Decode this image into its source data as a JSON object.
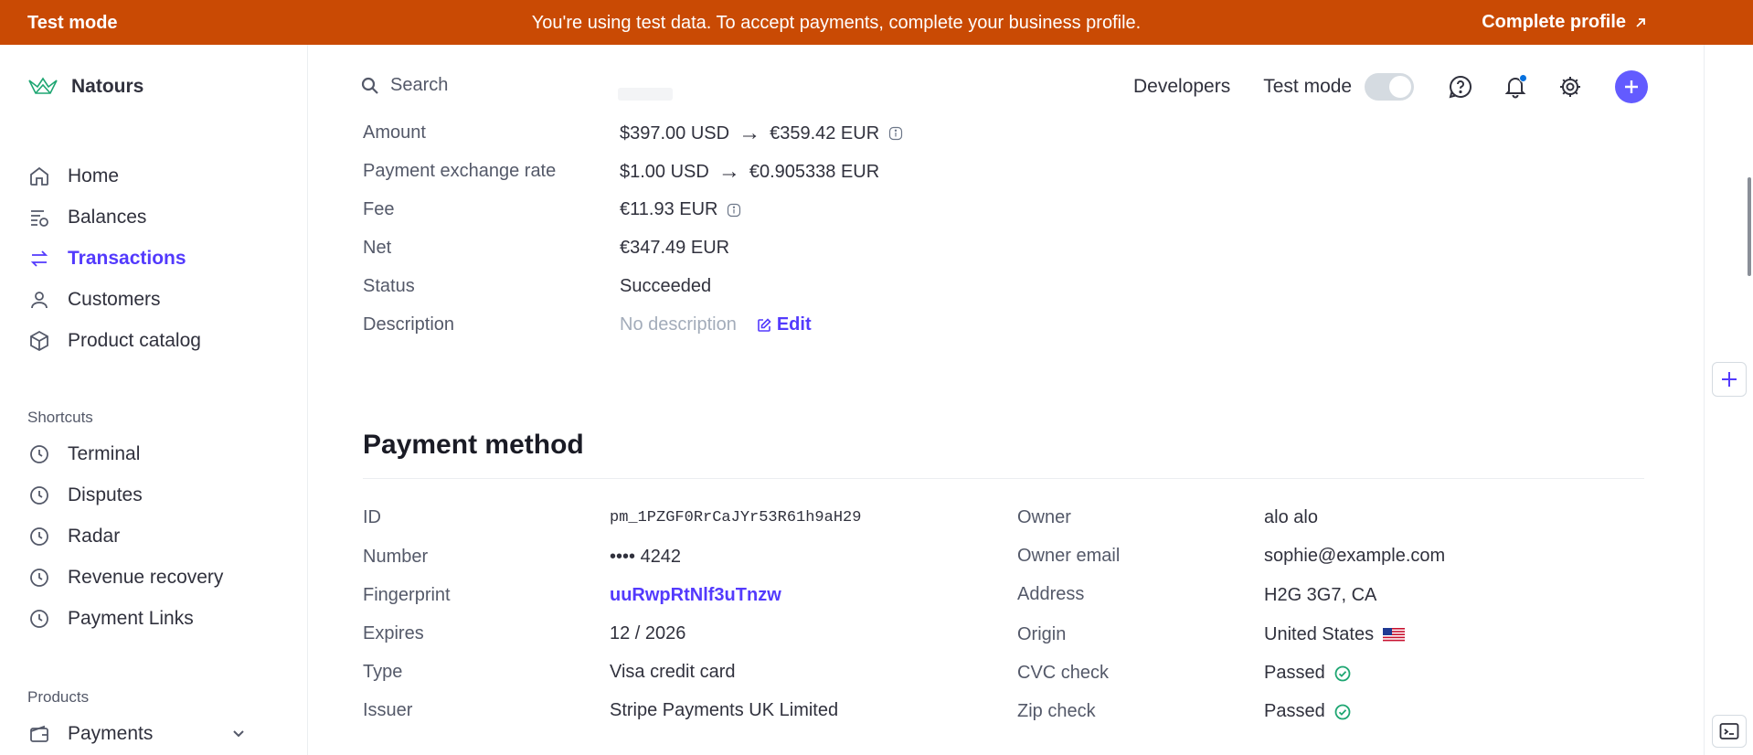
{
  "banner": {
    "mode_label": "Test mode",
    "message": "You're using test data. To accept payments, complete your business profile.",
    "cta": "Complete profile"
  },
  "brand": {
    "name": "Natours",
    "color": "#1ea672"
  },
  "nav": {
    "items": [
      {
        "label": "Home",
        "icon": "home-icon"
      },
      {
        "label": "Balances",
        "icon": "balances-icon"
      },
      {
        "label": "Transactions",
        "icon": "transactions-icon",
        "active": true
      },
      {
        "label": "Customers",
        "icon": "person-icon"
      },
      {
        "label": "Product catalog",
        "icon": "box-icon"
      }
    ],
    "shortcuts_label": "Shortcuts",
    "shortcuts": [
      {
        "label": "Terminal",
        "icon": "clock-icon"
      },
      {
        "label": "Disputes",
        "icon": "clock-icon"
      },
      {
        "label": "Radar",
        "icon": "clock-icon"
      },
      {
        "label": "Revenue recovery",
        "icon": "clock-icon"
      },
      {
        "label": "Payment Links",
        "icon": "clock-icon"
      }
    ],
    "products_label": "Products",
    "products": [
      {
        "label": "Payments",
        "icon": "wallet-icon"
      }
    ]
  },
  "topbar": {
    "search_placeholder": "Search",
    "developers": "Developers",
    "test_mode": "Test mode",
    "test_mode_on": false
  },
  "details": {
    "amount_label": "Amount",
    "amount_from": "$397.00 USD",
    "amount_to": "€359.42 EUR",
    "rate_label": "Payment exchange rate",
    "rate_from": "$1.00 USD",
    "rate_to": "€0.905338 EUR",
    "fee_label": "Fee",
    "fee": "€11.93 EUR",
    "net_label": "Net",
    "net": "€347.49 EUR",
    "status_label": "Status",
    "status": "Succeeded",
    "description_label": "Description",
    "description": "No description",
    "edit": "Edit"
  },
  "payment_method": {
    "title": "Payment method",
    "left": [
      {
        "label": "ID",
        "value": "pm_1PZGF0RrCaJYr53R61h9aH29"
      },
      {
        "label": "Number",
        "value": "•••• 4242"
      },
      {
        "label": "Fingerprint",
        "value": "uuRwpRtNlf3uTnzw"
      },
      {
        "label": "Expires",
        "value": "12 / 2026"
      },
      {
        "label": "Type",
        "value": "Visa credit card"
      },
      {
        "label": "Issuer",
        "value": "Stripe Payments UK Limited"
      }
    ],
    "right": [
      {
        "label": "Owner",
        "value": "alo alo"
      },
      {
        "label": "Owner email",
        "value": "sophie@example.com"
      },
      {
        "label": "Address",
        "value": "H2G 3G7, CA"
      },
      {
        "label": "Origin",
        "value": "United States"
      },
      {
        "label": "CVC check",
        "value": "Passed"
      },
      {
        "label": "Zip check",
        "value": "Passed"
      }
    ]
  },
  "colors": {
    "banner": "#c94a04",
    "accent": "#533afd",
    "success": "#1ea672"
  }
}
